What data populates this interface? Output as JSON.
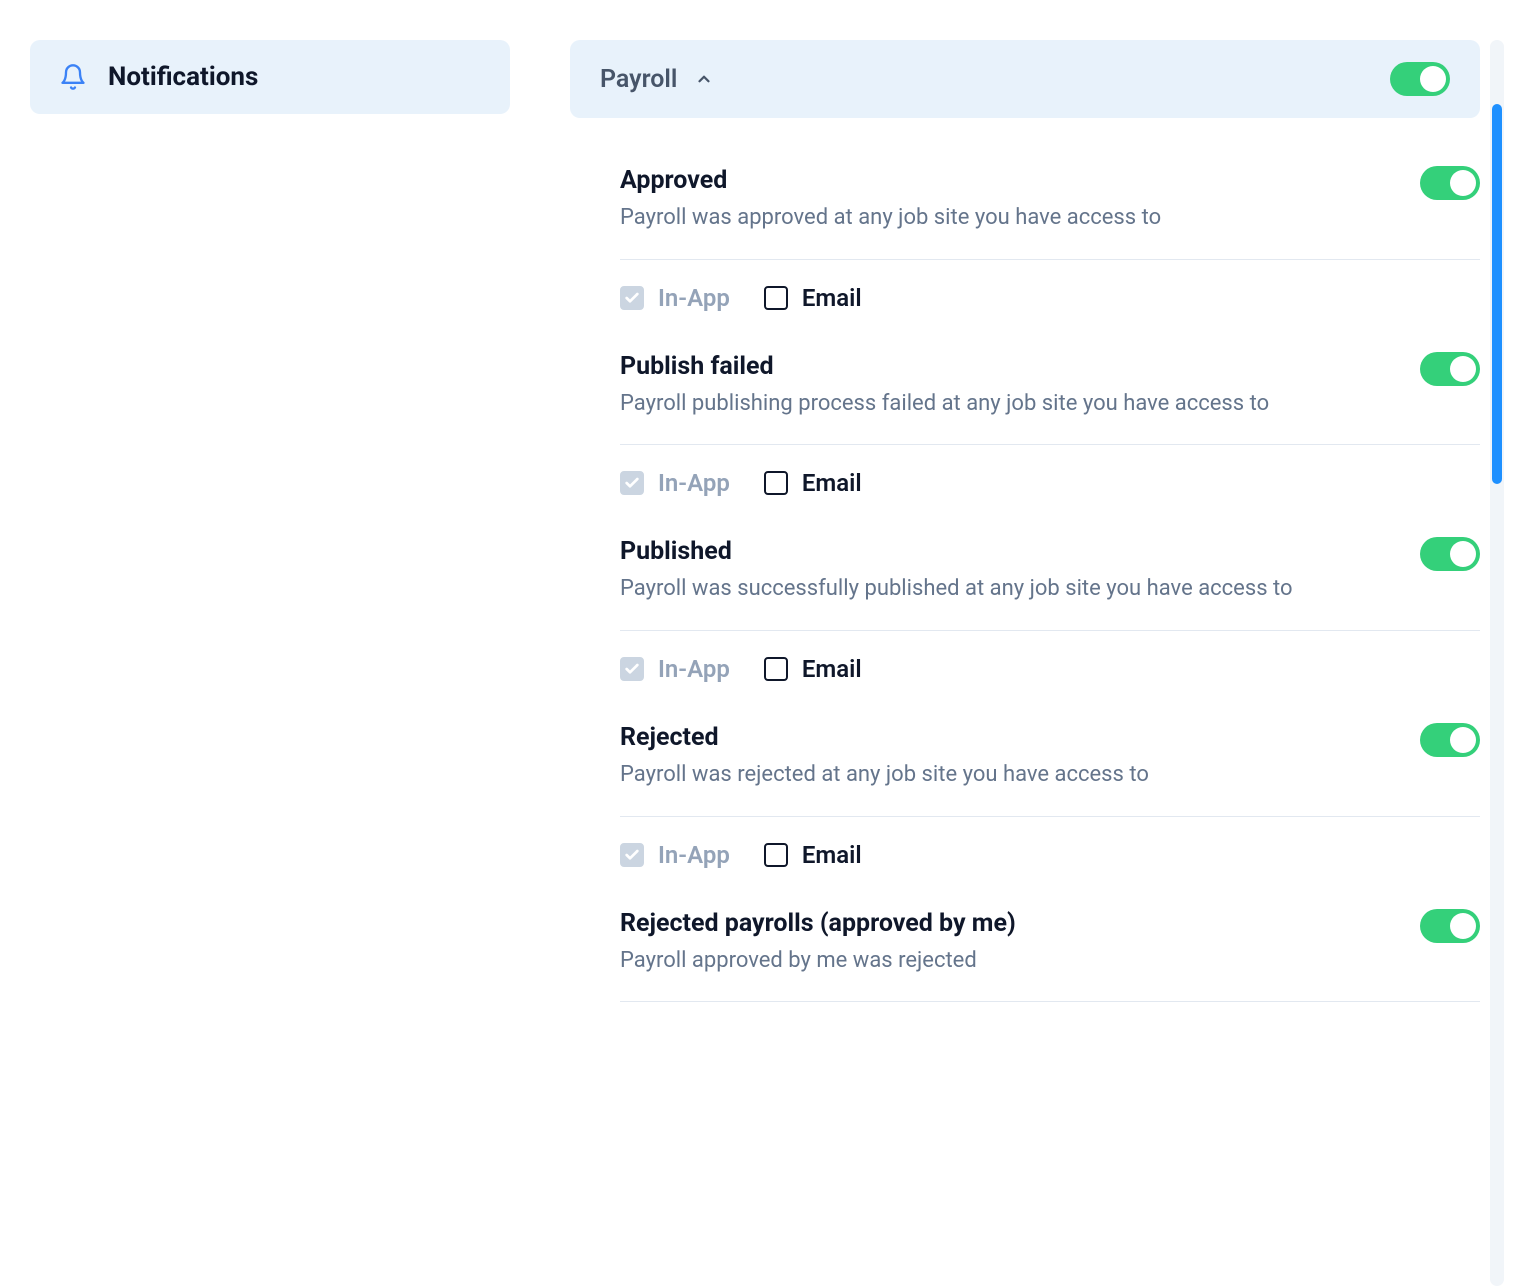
{
  "sidebar": {
    "active": {
      "label": "Notifications"
    }
  },
  "section": {
    "title": "Payroll",
    "expanded": true,
    "enabled": true
  },
  "channels": {
    "inapp": "In-App",
    "email": "Email"
  },
  "items": [
    {
      "title": "Approved",
      "desc": "Payroll was approved at any job site you have access to",
      "enabled": true,
      "inapp_checked": true,
      "inapp_locked": true,
      "email_checked": false
    },
    {
      "title": "Publish failed",
      "desc": "Payroll publishing process failed at any job site you have access to",
      "enabled": true,
      "inapp_checked": true,
      "inapp_locked": true,
      "email_checked": false
    },
    {
      "title": "Published",
      "desc": "Payroll was successfully published at any job site you have access to",
      "enabled": true,
      "inapp_checked": true,
      "inapp_locked": true,
      "email_checked": false
    },
    {
      "title": "Rejected",
      "desc": "Payroll was rejected at any job site you have access to",
      "enabled": true,
      "inapp_checked": true,
      "inapp_locked": true,
      "email_checked": false
    },
    {
      "title": "Rejected payrolls (approved by me)",
      "desc": "Payroll approved by me was rejected",
      "enabled": true,
      "inapp_checked": true,
      "inapp_locked": true,
      "email_checked": false
    }
  ]
}
